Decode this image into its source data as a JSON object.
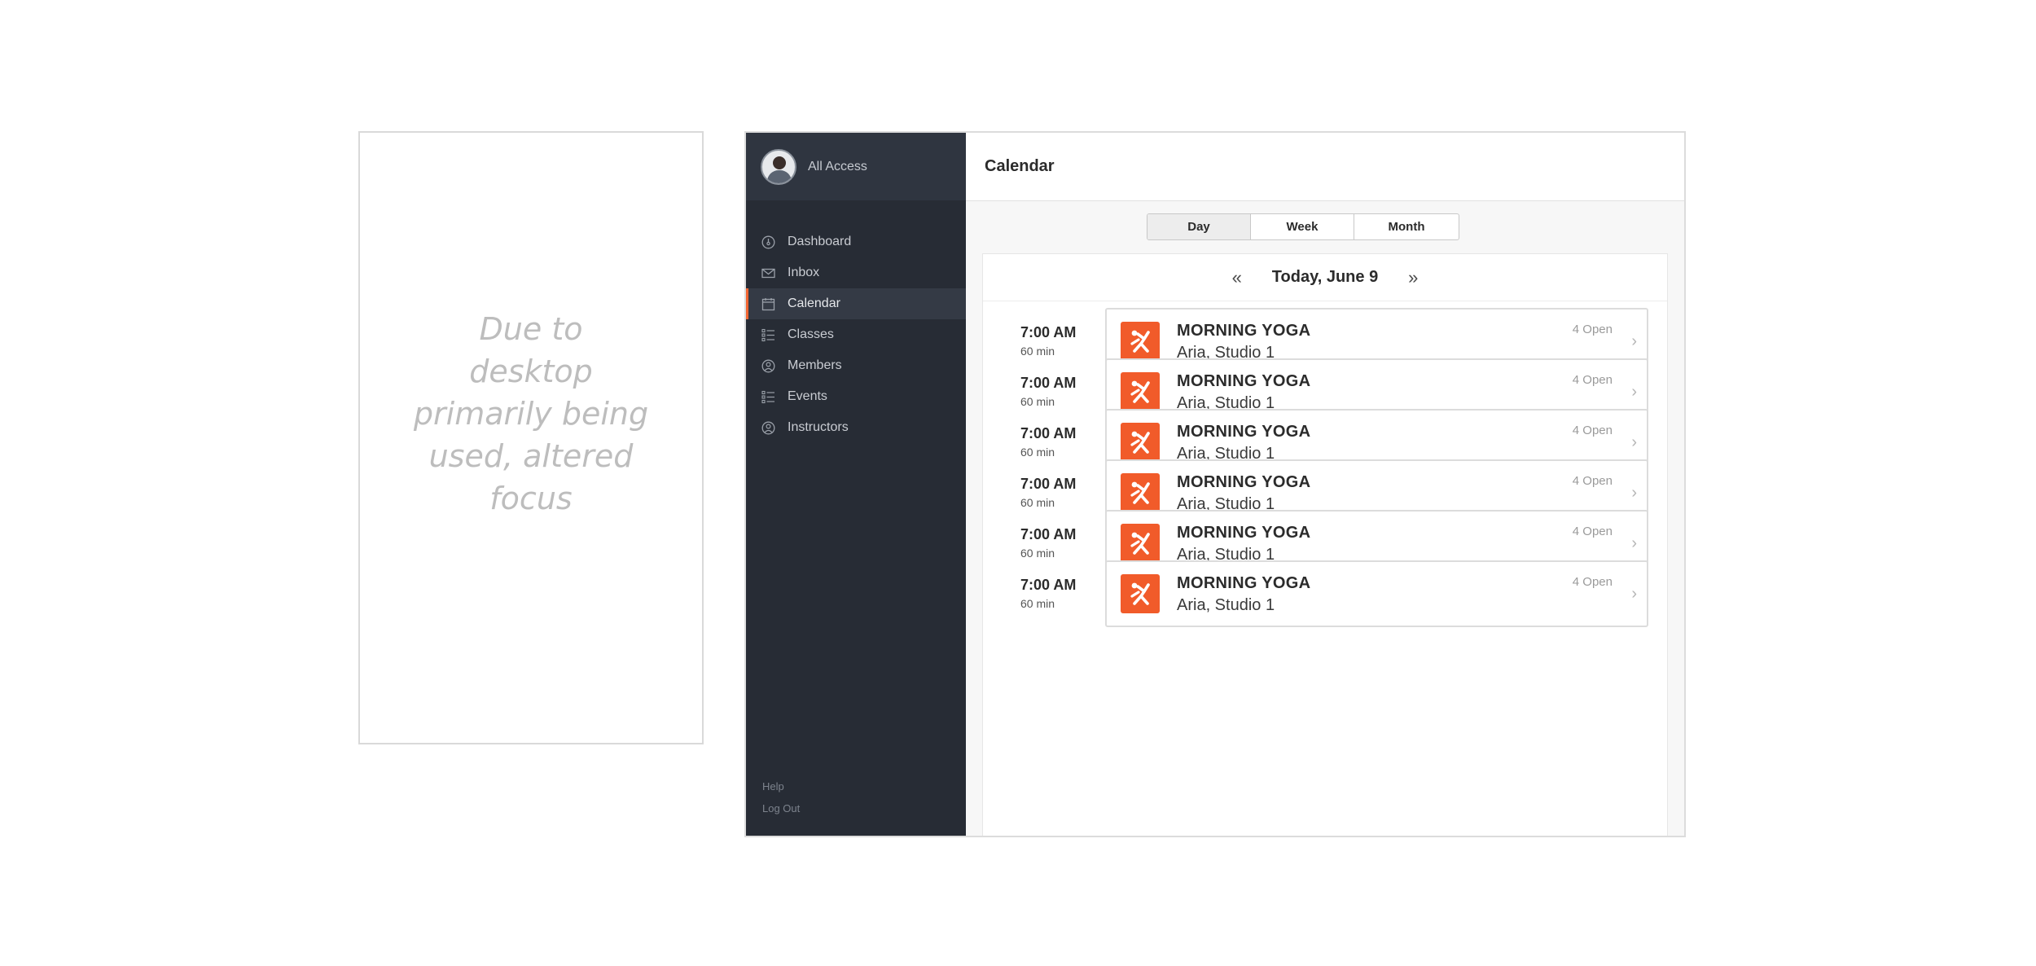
{
  "mobile_note": "Due to desktop primarily being used, altered focus",
  "profile": {
    "label": "All Access"
  },
  "nav": [
    {
      "label": "Dashboard",
      "icon": "dashboard-icon",
      "active": false
    },
    {
      "label": "Inbox",
      "icon": "mail-icon",
      "active": false
    },
    {
      "label": "Calendar",
      "icon": "calendar-icon",
      "active": true
    },
    {
      "label": "Classes",
      "icon": "list-icon",
      "active": false
    },
    {
      "label": "Members",
      "icon": "user-circle-icon",
      "active": false
    },
    {
      "label": "Events",
      "icon": "list-icon",
      "active": false
    },
    {
      "label": "Instructors",
      "icon": "user-circle-icon",
      "active": false
    }
  ],
  "footer": {
    "help": "Help",
    "logout": "Log Out"
  },
  "header": {
    "title": "Calendar"
  },
  "view_tabs": [
    {
      "label": "Day",
      "active": true
    },
    {
      "label": "Week",
      "active": false
    },
    {
      "label": "Month",
      "active": false
    }
  ],
  "date_nav": {
    "prev_icon": "double-chevron-left-icon",
    "label": "Today, June 9",
    "next_icon": "double-chevron-right-icon"
  },
  "classes": [
    {
      "time": "7:00 AM",
      "duration": "60 min",
      "name": "MORNING YOGA",
      "location": "Aria, Studio 1",
      "open": "4 Open"
    },
    {
      "time": "7:00 AM",
      "duration": "60 min",
      "name": "MORNING YOGA",
      "location": "Aria, Studio 1",
      "open": "4 Open"
    },
    {
      "time": "7:00 AM",
      "duration": "60 min",
      "name": "MORNING YOGA",
      "location": "Aria, Studio 1",
      "open": "4 Open"
    },
    {
      "time": "7:00 AM",
      "duration": "60 min",
      "name": "MORNING YOGA",
      "location": "Aria, Studio 1",
      "open": "4 Open"
    },
    {
      "time": "7:00 AM",
      "duration": "60 min",
      "name": "MORNING YOGA",
      "location": "Aria, Studio 1",
      "open": "4 Open"
    },
    {
      "time": "7:00 AM",
      "duration": "60 min",
      "name": "MORNING YOGA",
      "location": "Aria, Studio 1",
      "open": "4 Open"
    }
  ],
  "colors": {
    "accent": "#f15b2a",
    "sidebar": "#272c35"
  }
}
